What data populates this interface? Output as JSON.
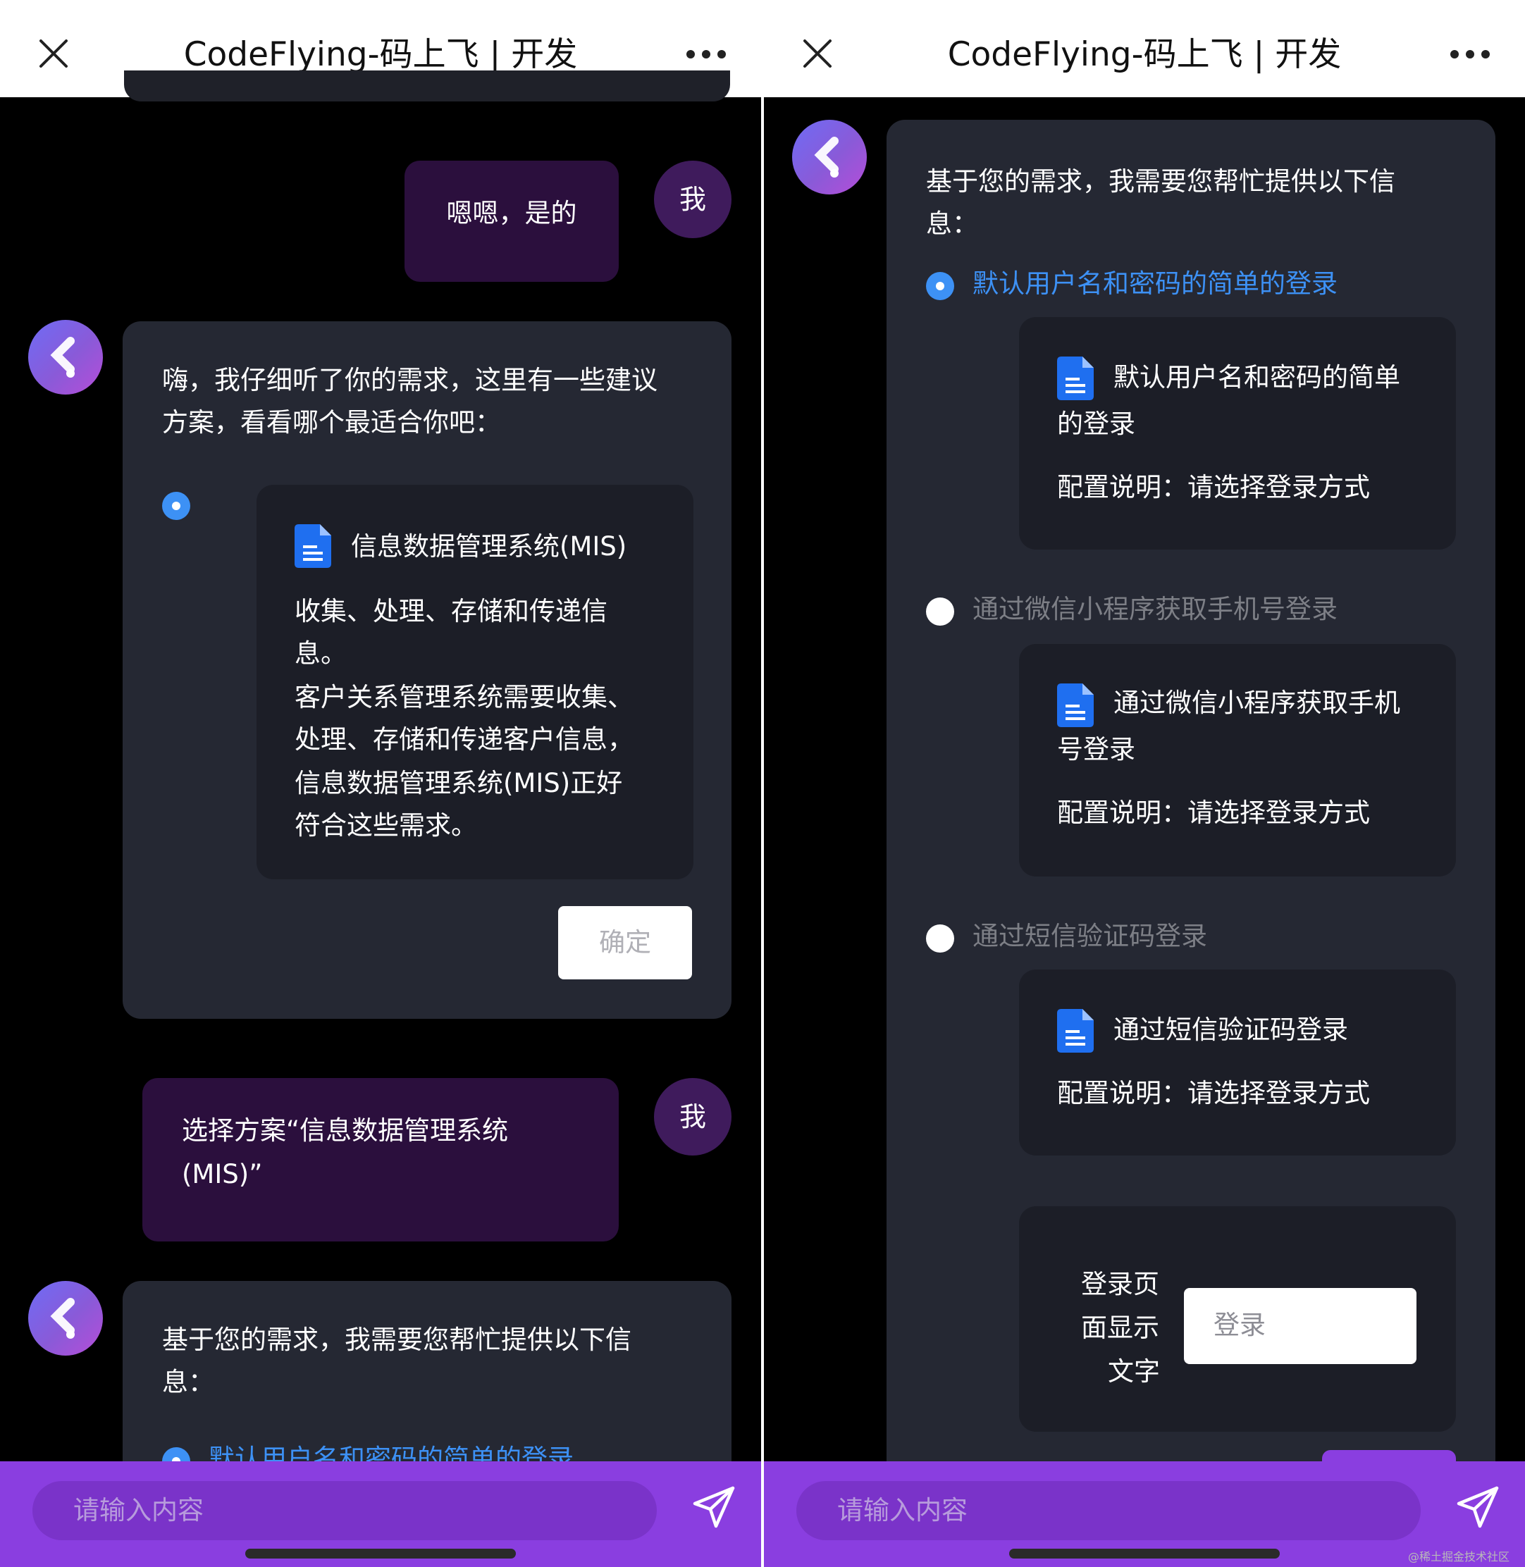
{
  "header": {
    "title": "CodeFlying-码上飞 | 开发"
  },
  "left": {
    "user_msg_1": "嗯嗯，是的",
    "me_label": "我",
    "bot_msg_1": [
      "嗨，我仔细听了你的需求，这里有一些建议",
      "方案，看看哪个最适合你吧："
    ],
    "option_title": "信息数据管理系统(MIS)",
    "option_desc": [
      "收集、处理、存储和传递信",
      "息。",
      "客户关系管理系统需要收集、",
      "处理、存储和传递客户信息，",
      "信息数据管理系统(MIS)正好",
      "符合这些需求。"
    ],
    "confirm": "确定",
    "user_msg_2": [
      "选择方案“信息数据管理系统",
      "(MIS)”"
    ],
    "bot_msg_2": [
      "基于您的需求，我需要您帮忙提供以下信",
      "息："
    ],
    "first_option": "默认用户名和密码的简单的登录"
  },
  "right": {
    "intro": [
      "基于您的需求，我需要您帮忙提供以下信",
      "息："
    ],
    "options": [
      {
        "label": "默认用户名和密码的简单的登录",
        "selected": true,
        "card_title": [
          "默认用户名和密码的简单",
          "的登录"
        ],
        "config": "配置说明：请选择登录方式"
      },
      {
        "label": "通过微信小程序获取手机号登录",
        "selected": false,
        "card_title": [
          "通过微信小程序获取手机",
          "号登录"
        ],
        "config": "配置说明：请选择登录方式"
      },
      {
        "label": "通过短信验证码登录",
        "selected": false,
        "card_title": [
          "通过短信验证码登录"
        ],
        "config": "配置说明：请选择登录方式"
      }
    ],
    "field_label": [
      "登录页",
      "面显示",
      "文字"
    ],
    "field_value": "登录"
  },
  "bottom": {
    "placeholder": "请输入内容"
  },
  "watermark": "@稀土掘金技术社区",
  "colors": {
    "accent_blue": "#3d91f5",
    "bar_purple": "#8a3ee0",
    "user_bubble": "#2b0f3d",
    "card_bg": "#252833"
  }
}
